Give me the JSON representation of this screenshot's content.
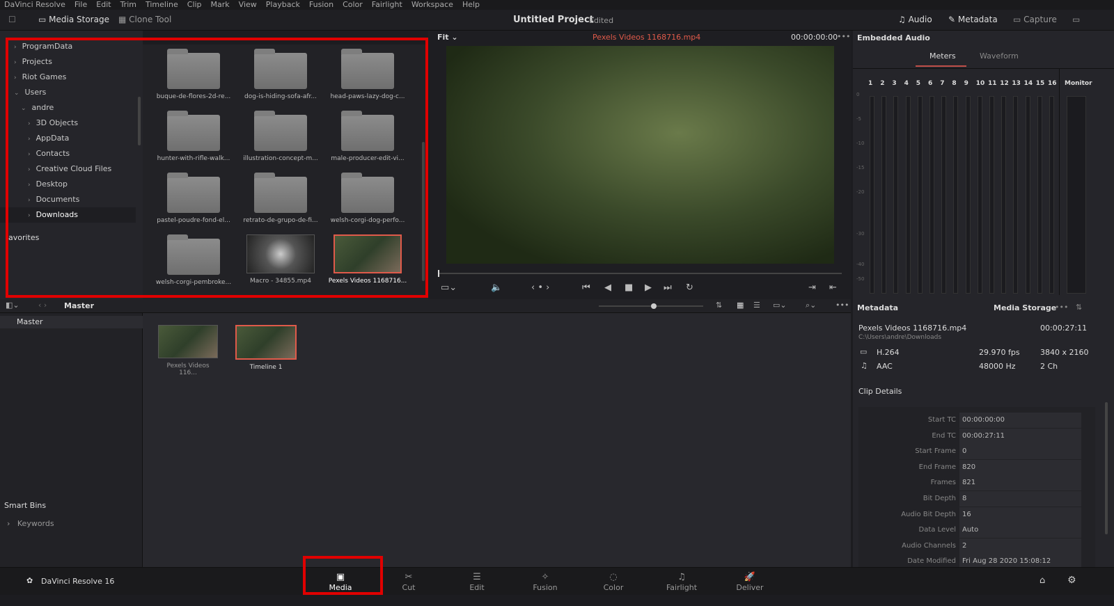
{
  "menu": [
    "DaVinci Resolve",
    "File",
    "Edit",
    "Trim",
    "Timeline",
    "Clip",
    "Mark",
    "View",
    "Playback",
    "Fusion",
    "Color",
    "Fairlight",
    "Workspace",
    "Help"
  ],
  "toolbar": {
    "media_storage": "Media Storage",
    "clone_tool": "Clone Tool",
    "project_title": "Untitled Project",
    "project_status": "Edited",
    "audio": "Audio",
    "metadata": "Metadata",
    "capture": "Capture"
  },
  "tree": {
    "items": [
      {
        "label": "ProgramData",
        "level": 0,
        "open": false
      },
      {
        "label": "Projects",
        "level": 0,
        "open": false
      },
      {
        "label": "Riot Games",
        "level": 0,
        "open": false
      },
      {
        "label": "Users",
        "level": 0,
        "open": true
      },
      {
        "label": "andre",
        "level": 1,
        "open": true
      },
      {
        "label": "3D Objects",
        "level": 2,
        "open": false
      },
      {
        "label": "AppData",
        "level": 2,
        "open": false
      },
      {
        "label": "Contacts",
        "level": 2,
        "open": false
      },
      {
        "label": "Creative Cloud Files",
        "level": 2,
        "open": false
      },
      {
        "label": "Desktop",
        "level": 2,
        "open": false
      },
      {
        "label": "Documents",
        "level": 2,
        "open": false
      },
      {
        "label": "Downloads",
        "level": 2,
        "open": false,
        "selected": true
      }
    ],
    "favorites": "avorites"
  },
  "thumbs": [
    {
      "label": "buque-de-flores-2d-re...",
      "type": "folder"
    },
    {
      "label": "dog-is-hiding-sofa-afr...",
      "type": "folder"
    },
    {
      "label": "head-paws-lazy-dog-c...",
      "type": "folder"
    },
    {
      "label": "hunter-with-rifle-walk...",
      "type": "folder"
    },
    {
      "label": "illustration-concept-m...",
      "type": "folder"
    },
    {
      "label": "male-producer-edit-vi...",
      "type": "folder"
    },
    {
      "label": "pastel-poudre-fond-el...",
      "type": "folder"
    },
    {
      "label": "retrato-de-grupo-de-fi...",
      "type": "folder"
    },
    {
      "label": "welsh-corgi-dog-perfo...",
      "type": "folder"
    },
    {
      "label": "welsh-corgi-pembroke...",
      "type": "folder"
    },
    {
      "label": "Macro - 34855.mp4",
      "type": "macro"
    },
    {
      "label": "Pexels Videos 1168716...",
      "type": "video",
      "selected": true
    }
  ],
  "viewer": {
    "zoom": "Fit",
    "clip_name": "Pexels Videos 1168716.mp4",
    "timecode": "00:00:00:00",
    "clip_color": "#e05a4a"
  },
  "audio_panel": {
    "title": "Embedded Audio",
    "tabs": [
      "Meters",
      "Waveform"
    ],
    "active_tab": "Meters",
    "channels": [
      "1",
      "2",
      "3",
      "4",
      "5",
      "6",
      "7",
      "8",
      "9",
      "10",
      "11",
      "12",
      "13",
      "14",
      "15",
      "16"
    ],
    "monitor": "Monitor",
    "scale": [
      "0",
      "-5",
      "-10",
      "-15",
      "-20",
      "-30",
      "-40",
      "-50"
    ]
  },
  "pool": {
    "bin": "Master",
    "bins": [
      "Master"
    ],
    "smart_bins": "Smart Bins",
    "keywords": "Keywords",
    "clips": [
      {
        "label": "Pexels Videos 116..."
      },
      {
        "label": "Timeline 1",
        "selected": true
      }
    ]
  },
  "metadata": {
    "title": "Metadata",
    "source": "Media Storage",
    "clip": "Pexels Videos 1168716.mp4",
    "duration": "00:00:27:11",
    "path": "C:\\Users\\andre\\Downloads",
    "video_codec": "H.264",
    "fps": "29.970 fps",
    "resolution": "3840 x 2160",
    "audio_codec": "AAC",
    "sample_rate": "48000 Hz",
    "channels": "2 Ch",
    "section": "Clip Details",
    "fields": [
      {
        "label": "Start TC",
        "value": "00:00:00:00"
      },
      {
        "label": "End TC",
        "value": "00:00:27:11"
      },
      {
        "label": "Start Frame",
        "value": "0"
      },
      {
        "label": "End Frame",
        "value": "820"
      },
      {
        "label": "Frames",
        "value": "821"
      },
      {
        "label": "Bit Depth",
        "value": "8"
      },
      {
        "label": "Audio Bit Depth",
        "value": "16"
      },
      {
        "label": "Data Level",
        "value": "Auto"
      },
      {
        "label": "Audio Channels",
        "value": "2"
      },
      {
        "label": "Date Modified",
        "value": "Fri Aug 28 2020 15:08:12"
      }
    ]
  },
  "bottom": {
    "app": "DaVinci Resolve 16",
    "pages": [
      "Media",
      "Cut",
      "Edit",
      "Fusion",
      "Color",
      "Fairlight",
      "Deliver"
    ],
    "active": "Media"
  },
  "accent": "#e00000"
}
